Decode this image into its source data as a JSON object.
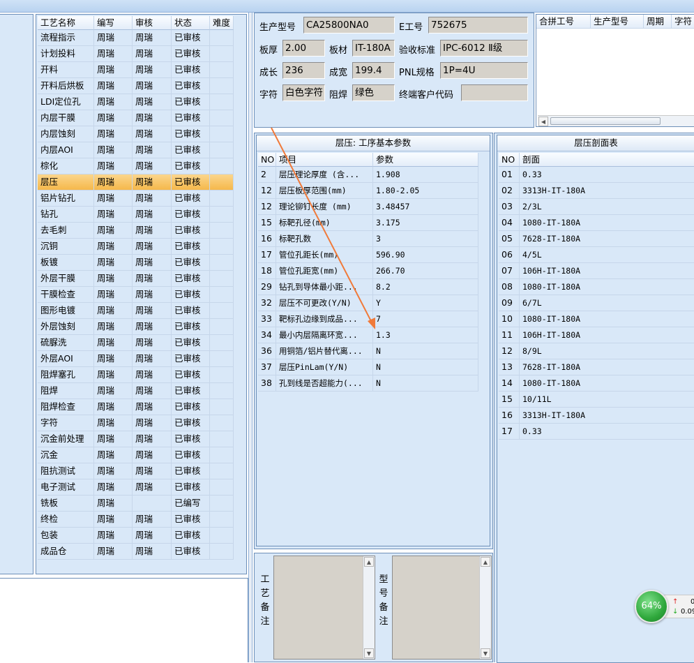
{
  "process_list": {
    "headers": [
      "工艺名称",
      "编写",
      "审核",
      "状态",
      "难度"
    ],
    "selected_index": 9,
    "rows": [
      [
        "流程指示",
        "周瑞",
        "周瑞",
        "已审核",
        ""
      ],
      [
        "计划投料",
        "周瑞",
        "周瑞",
        "已审核",
        ""
      ],
      [
        "开料",
        "周瑞",
        "周瑞",
        "已审核",
        ""
      ],
      [
        "开料后烘板",
        "周瑞",
        "周瑞",
        "已审核",
        ""
      ],
      [
        "LDI定位孔",
        "周瑞",
        "周瑞",
        "已审核",
        ""
      ],
      [
        "内层干膜",
        "周瑞",
        "周瑞",
        "已审核",
        ""
      ],
      [
        "内层蚀刻",
        "周瑞",
        "周瑞",
        "已审核",
        ""
      ],
      [
        "内层AOI",
        "周瑞",
        "周瑞",
        "已审核",
        ""
      ],
      [
        "棕化",
        "周瑞",
        "周瑞",
        "已审核",
        ""
      ],
      [
        "层压",
        "周瑞",
        "周瑞",
        "已审核",
        ""
      ],
      [
        "铝片钻孔",
        "周瑞",
        "周瑞",
        "已审核",
        ""
      ],
      [
        "钻孔",
        "周瑞",
        "周瑞",
        "已审核",
        ""
      ],
      [
        "去毛刺",
        "周瑞",
        "周瑞",
        "已审核",
        ""
      ],
      [
        "沉铜",
        "周瑞",
        "周瑞",
        "已审核",
        ""
      ],
      [
        "板镀",
        "周瑞",
        "周瑞",
        "已审核",
        ""
      ],
      [
        "外层干膜",
        "周瑞",
        "周瑞",
        "已审核",
        ""
      ],
      [
        "干膜检查",
        "周瑞",
        "周瑞",
        "已审核",
        ""
      ],
      [
        "图形电镀",
        "周瑞",
        "周瑞",
        "已审核",
        ""
      ],
      [
        "外层蚀刻",
        "周瑞",
        "周瑞",
        "已审核",
        ""
      ],
      [
        "硫脲洗",
        "周瑞",
        "周瑞",
        "已审核",
        ""
      ],
      [
        "外层AOI",
        "周瑞",
        "周瑞",
        "已审核",
        ""
      ],
      [
        "阻焊塞孔",
        "周瑞",
        "周瑞",
        "已审核",
        ""
      ],
      [
        "阻焊",
        "周瑞",
        "周瑞",
        "已审核",
        ""
      ],
      [
        "阻焊检查",
        "周瑞",
        "周瑞",
        "已审核",
        ""
      ],
      [
        "字符",
        "周瑞",
        "周瑞",
        "已审核",
        ""
      ],
      [
        "沉金前处理",
        "周瑞",
        "周瑞",
        "已审核",
        ""
      ],
      [
        "沉金",
        "周瑞",
        "周瑞",
        "已审核",
        ""
      ],
      [
        "阻抗测试",
        "周瑞",
        "周瑞",
        "已审核",
        ""
      ],
      [
        "电子测试",
        "周瑞",
        "周瑞",
        "已审核",
        ""
      ],
      [
        "铣板",
        "周瑞",
        "",
        "已编写",
        ""
      ],
      [
        "终检",
        "周瑞",
        "周瑞",
        "已审核",
        ""
      ],
      [
        "包装",
        "周瑞",
        "周瑞",
        "已审核",
        ""
      ],
      [
        "成品仓",
        "周瑞",
        "周瑞",
        "已审核",
        ""
      ]
    ]
  },
  "info": {
    "model_label": "生产型号",
    "model_value": "CA25800NA0",
    "e_label": "E工号",
    "e_value": "752675",
    "thickness_label": "板厚",
    "thickness_value": "2.00",
    "material_label": "板材",
    "material_value": "IT-180A",
    "standard_label": "验收标准",
    "standard_value": "IPC-6012 Ⅱ级",
    "grow_label": "成长",
    "grow_value": "236",
    "width_label": "成宽",
    "width_value": "199.4",
    "pnl_label": "PNL规格",
    "pnl_value": "1P=4U",
    "char_label": "字符",
    "char_value": "白色字符",
    "mask_label": "阻焊",
    "mask_value": "绿色",
    "customer_label": "终端客户代码",
    "customer_value": ""
  },
  "merge_table": {
    "headers": [
      "合拼工号",
      "生产型号",
      "周期",
      "字符"
    ]
  },
  "params_panel": {
    "title": "层压: 工序基本参数",
    "headers": [
      "NO",
      "项目",
      "参数"
    ],
    "rows": [
      [
        "2",
        "层压理论厚度 (含...",
        "1.908"
      ],
      [
        "12",
        "层压板厚范围(mm)",
        "1.80-2.05"
      ],
      [
        "12",
        "理论铆钉长度 (mm)",
        "3.48457"
      ],
      [
        "15",
        "标靶孔径(mm)",
        "3.175"
      ],
      [
        "16",
        "标靶孔数",
        "3"
      ],
      [
        "17",
        "管位孔距长(mm)",
        "596.90"
      ],
      [
        "18",
        "管位孔距宽(mm)",
        "266.70"
      ],
      [
        "29",
        "钻孔到导体最小距...",
        "8.2"
      ],
      [
        "32",
        "层压不可更改(Y/N)",
        "Y"
      ],
      [
        "33",
        "靶标孔边缘到成品...",
        "7"
      ],
      [
        "34",
        "最小内层隔离环宽...",
        "1.3"
      ],
      [
        "36",
        "用铜箔/铝片替代离...",
        "N"
      ],
      [
        "37",
        "层压PinLam(Y/N)",
        "N"
      ],
      [
        "38",
        "孔到线是否超能力(...",
        "N"
      ]
    ]
  },
  "stackup_panel": {
    "title": "层压剖面表",
    "headers": [
      "NO",
      "剖面"
    ],
    "rows": [
      [
        "01",
        "0.33"
      ],
      [
        "02",
        "3313H-IT-180A"
      ],
      [
        "03",
        "2/3L"
      ],
      [
        "04",
        "1080-IT-180A"
      ],
      [
        "05",
        "7628-IT-180A"
      ],
      [
        "06",
        "4/5L"
      ],
      [
        "07",
        "106H-IT-180A"
      ],
      [
        "08",
        "1080-IT-180A"
      ],
      [
        "09",
        "6/7L"
      ],
      [
        "10",
        "1080-IT-180A"
      ],
      [
        "11",
        "106H-IT-180A"
      ],
      [
        "12",
        "8/9L"
      ],
      [
        "13",
        "7628-IT-180A"
      ],
      [
        "14",
        "1080-IT-180A"
      ],
      [
        "15",
        "10/11L"
      ],
      [
        "16",
        "3313H-IT-180A"
      ],
      [
        "17",
        "0.33"
      ]
    ]
  },
  "remarks": {
    "process_label": "工艺备注",
    "model_label": "型号备注"
  },
  "widget": {
    "percent": "64%",
    "up": "0",
    "down": "0.09"
  },
  "colors": {
    "panel_bg": "#d9e8f8",
    "selected_row": "#f5b84b",
    "arrow": "#f07a3a",
    "widget_green": "#3bb34a"
  }
}
